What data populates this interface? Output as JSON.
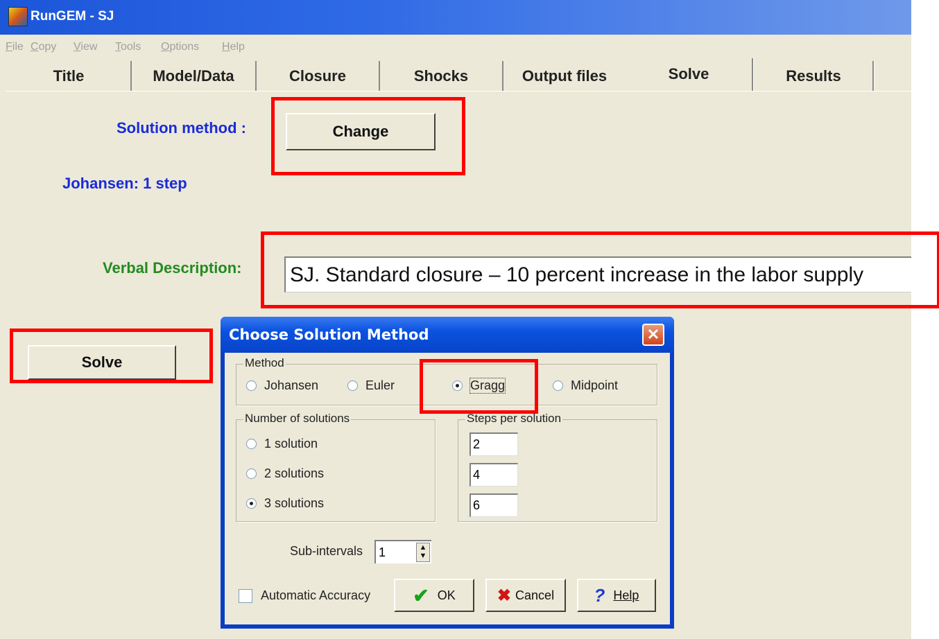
{
  "window": {
    "title": "RunGEM - SJ"
  },
  "menu": [
    {
      "label": "File",
      "u": "F",
      "rest": "ile"
    },
    {
      "label": "Copy",
      "u": "C",
      "rest": "opy"
    },
    {
      "label": "View",
      "u": "V",
      "rest": "iew"
    },
    {
      "label": "Tools",
      "u": "T",
      "rest": "ools"
    },
    {
      "label": "Options",
      "u": "O",
      "rest": "ptions"
    },
    {
      "label": "Help",
      "u": "H",
      "rest": "elp"
    }
  ],
  "tabs": [
    "Title",
    "Model/Data",
    "Closure",
    "Shocks",
    "Output files",
    "Solve",
    "Results"
  ],
  "active_tab": "Solve",
  "solve_page": {
    "solution_method_label": "Solution method :",
    "change_button": "Change",
    "current_method": "Johansen: 1 step",
    "verbal_description_label": "Verbal Description:",
    "verbal_description_value": "SJ. Standard closure – 10 percent increase in the labor supply",
    "solve_button": "Solve"
  },
  "dialog": {
    "title": "Choose Solution Method",
    "close": "✕",
    "method_group": "Method",
    "methods": [
      "Johansen",
      "Euler",
      "Gragg",
      "Midpoint"
    ],
    "selected_method": "Gragg",
    "solutions_group": "Number of solutions",
    "solutions": [
      "1 solution",
      "2 solutions",
      "3 solutions"
    ],
    "selected_solutions": "3 solutions",
    "steps_group": "Steps per solution",
    "steps": [
      "2",
      "4",
      "6"
    ],
    "subintervals_label": "Sub-intervals",
    "subintervals_value": "1",
    "automatic_accuracy": "Automatic Accuracy",
    "ok": "OK",
    "cancel": "Cancel",
    "help": "Help"
  },
  "colors": {
    "highlight": "#ff0000",
    "label_blue": "#1a2bd8",
    "label_green": "#228b22"
  }
}
